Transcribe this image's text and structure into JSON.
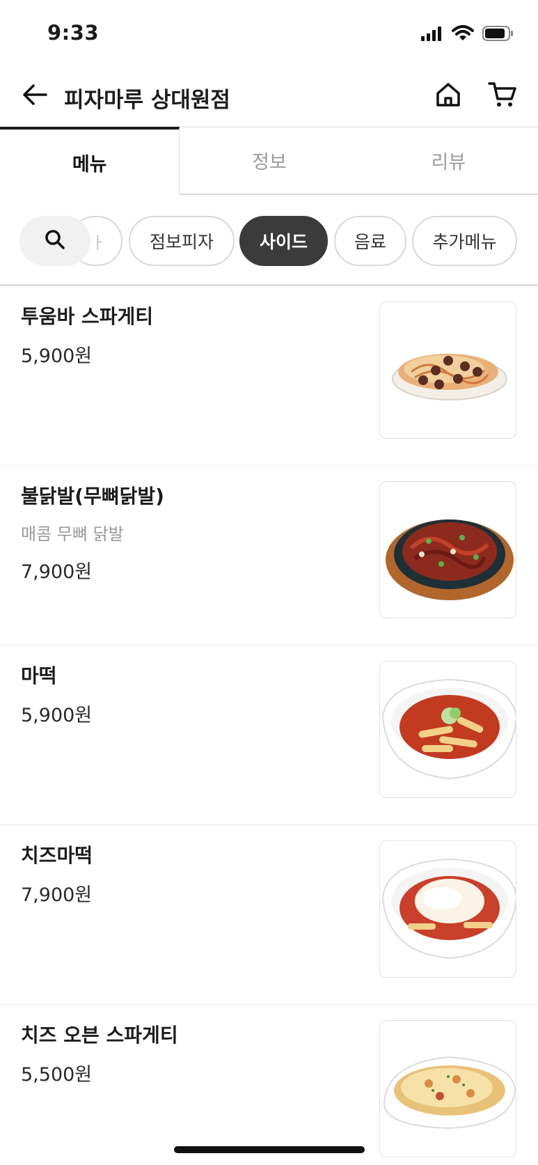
{
  "status_bar": {
    "time": "9:33"
  },
  "header": {
    "store_name": "피자마루 상대원점"
  },
  "tabs": [
    {
      "label": "메뉴",
      "active": true
    },
    {
      "label": "정보",
      "active": false
    },
    {
      "label": "리뷰",
      "active": false
    }
  ],
  "categories": {
    "partial_label": "ㅏ",
    "items": [
      {
        "label": "점보피자",
        "selected": false
      },
      {
        "label": "사이드",
        "selected": true
      },
      {
        "label": "음료",
        "selected": false
      },
      {
        "label": "추가메뉴",
        "selected": false
      }
    ]
  },
  "menu_items": [
    {
      "name": "투움바 스파게티",
      "description": "",
      "price": "5,900원",
      "image": "tuscan-pasta-dish"
    },
    {
      "name": "불닭발(무뼈닭발)",
      "description": "매콤 무뼈 닭발",
      "price": "7,900원",
      "image": "spicy-chicken-feet-pan"
    },
    {
      "name": "마떡",
      "description": "",
      "price": "5,900원",
      "image": "tteokbokki-bowl"
    },
    {
      "name": "치즈마떡",
      "description": "",
      "price": "7,900원",
      "image": "cheese-tteokbokki-bowl"
    },
    {
      "name": "치즈 오븐 스파게티",
      "description": "",
      "price": "5,500원",
      "image": "cheese-oven-spaghetti-dish"
    }
  ],
  "colors": {
    "selected_chip": "#3b3b3b",
    "text_primary": "#1c1c1c",
    "text_muted": "#9a9a9a"
  }
}
